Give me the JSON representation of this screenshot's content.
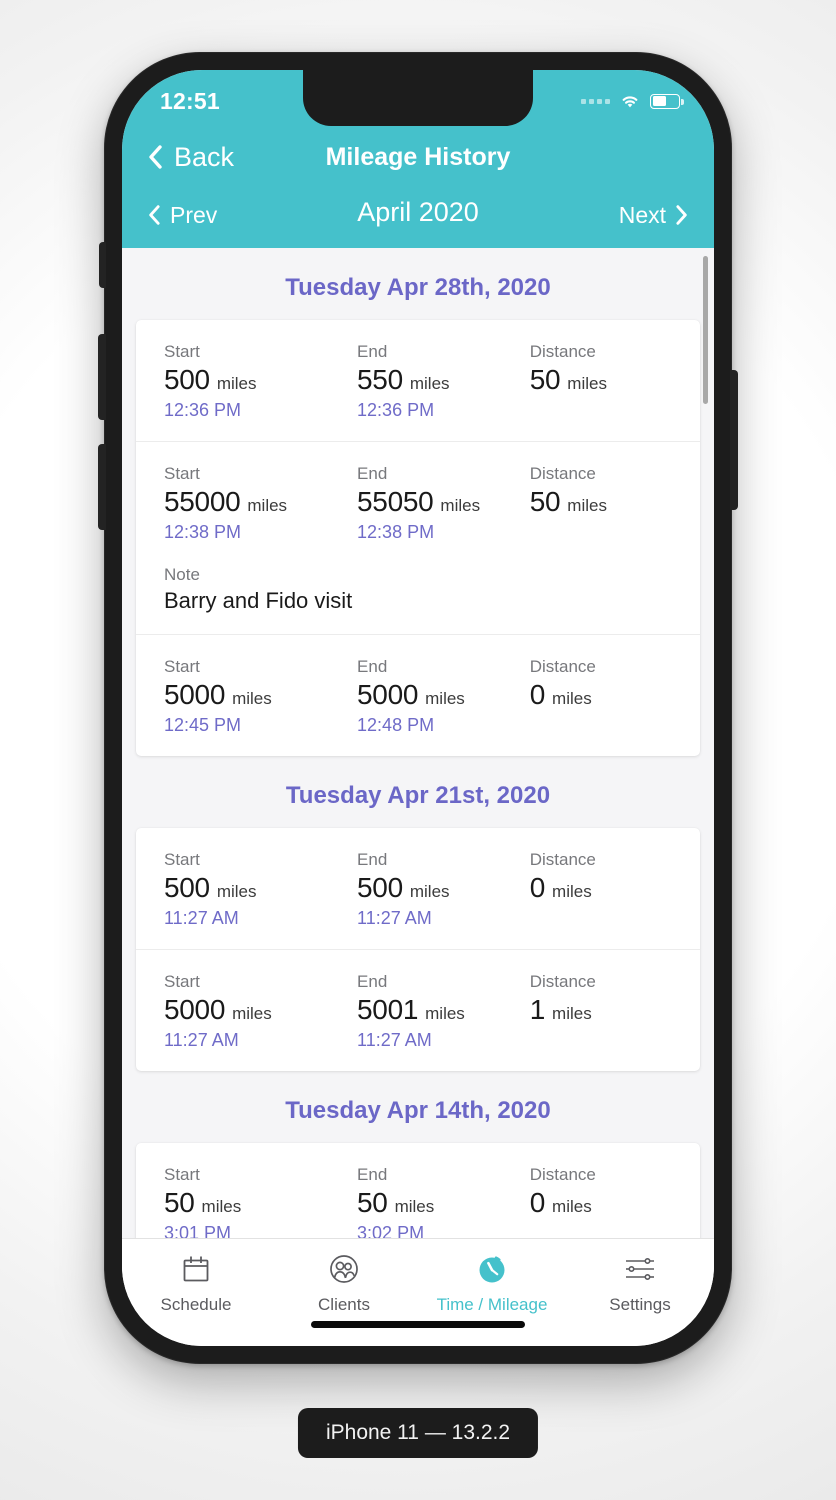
{
  "device": {
    "caption": "iPhone 11 — 13.2.2"
  },
  "status_bar": {
    "time": "12:51",
    "signal_icon": "cellular-dots-icon",
    "wifi_icon": "wifi-icon",
    "battery_icon": "battery-icon",
    "battery_level_pct": 52
  },
  "nav_bar": {
    "back_label": "Back",
    "back_icon": "chevron-left-icon",
    "title": "Mileage History"
  },
  "month_pager": {
    "prev_label": "Prev",
    "prev_icon": "chevron-left-icon",
    "month_label": "April 2020",
    "next_label": "Next",
    "next_icon": "chevron-right-icon"
  },
  "labels": {
    "start": "Start",
    "end": "End",
    "distance": "Distance",
    "unit": "miles",
    "note": "Note"
  },
  "colors": {
    "header_teal": "#45c1cb",
    "accent_purple": "#6b67c7",
    "content_bg": "#f5f5f7",
    "card_bg": "#ffffff"
  },
  "sections": [
    {
      "date": "Tuesday Apr 28th, 2020",
      "entries": [
        {
          "start_value": "500",
          "start_time": "12:36 PM",
          "end_value": "550",
          "end_time": "12:36 PM",
          "distance_value": "50",
          "note": null
        },
        {
          "start_value": "55000",
          "start_time": "12:38 PM",
          "end_value": "55050",
          "end_time": "12:38 PM",
          "distance_value": "50",
          "note": "Barry and Fido visit"
        },
        {
          "start_value": "5000",
          "start_time": "12:45 PM",
          "end_value": "5000",
          "end_time": "12:48 PM",
          "distance_value": "0",
          "note": null
        }
      ]
    },
    {
      "date": "Tuesday Apr 21st, 2020",
      "entries": [
        {
          "start_value": "500",
          "start_time": "11:27 AM",
          "end_value": "500",
          "end_time": "11:27 AM",
          "distance_value": "0",
          "note": null
        },
        {
          "start_value": "5000",
          "start_time": "11:27 AM",
          "end_value": "5001",
          "end_time": "11:27 AM",
          "distance_value": "1",
          "note": null
        }
      ]
    },
    {
      "date": "Tuesday Apr 14th, 2020",
      "entries": [
        {
          "start_value": "50",
          "start_time": "3:01 PM",
          "end_value": "50",
          "end_time": "3:02 PM",
          "distance_value": "0",
          "note": ""
        }
      ]
    }
  ],
  "tab_bar": {
    "items": [
      {
        "label": "Schedule",
        "icon": "calendar-icon",
        "active": false
      },
      {
        "label": "Clients",
        "icon": "people-icon",
        "active": false
      },
      {
        "label": "Time / Mileage",
        "icon": "stopwatch-icon",
        "active": true
      },
      {
        "label": "Settings",
        "icon": "sliders-icon",
        "active": false
      }
    ]
  }
}
